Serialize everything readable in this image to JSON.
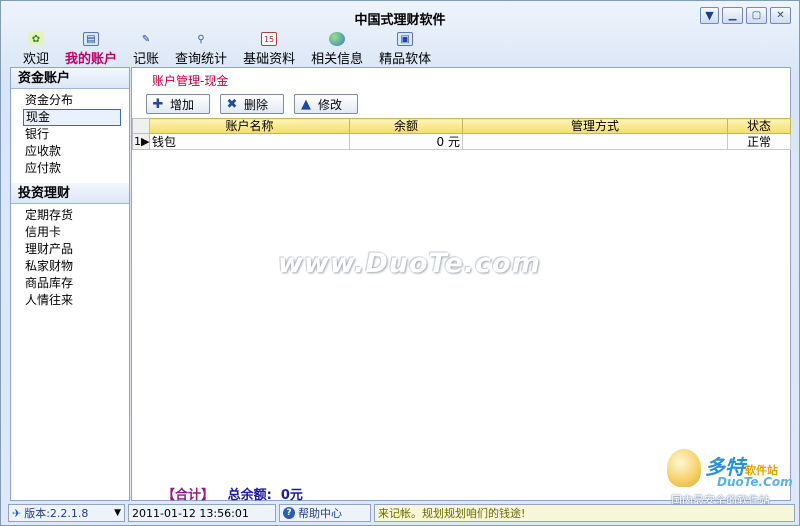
{
  "window": {
    "title": "中国式理财软件"
  },
  "toolbar": {
    "items": [
      {
        "label": "欢迎",
        "icon": "welcome-icon"
      },
      {
        "label": "我的账户",
        "icon": "account-icon",
        "active": true
      },
      {
        "label": "记账",
        "icon": "pen-icon"
      },
      {
        "label": "查询统计",
        "icon": "magnifier-icon"
      },
      {
        "label": "基础资料",
        "icon": "calendar-icon"
      },
      {
        "label": "相关信息",
        "icon": "globe-icon"
      },
      {
        "label": "精品软体",
        "icon": "window-icon"
      }
    ]
  },
  "sidebar": {
    "funds": {
      "header": "资金账户",
      "items": [
        "资金分布",
        "现金",
        "银行",
        "应收款",
        "应付款"
      ],
      "selected": "现金"
    },
    "invest": {
      "header": "投资理财",
      "items": [
        "定期存货",
        "信用卡",
        "理财产品",
        "私家财物",
        "商品库存",
        "人情往来"
      ]
    }
  },
  "main": {
    "breadcrumb": "账户管理-现金",
    "buttons": {
      "add": "增加",
      "delete": "删除",
      "edit": "修改"
    },
    "table": {
      "columns": [
        "账户名称",
        "余额",
        "管理方式",
        "状态"
      ],
      "rows": [
        {
          "index": "1",
          "name": "钱包",
          "balance": "0 元",
          "method": "",
          "status": "正常"
        }
      ]
    },
    "watermark": "www.DuoTe.com",
    "summary": {
      "label": "【合计】",
      "total_label": "总余额:",
      "total_value": "0元"
    }
  },
  "brand": {
    "name": "多特",
    "suffix": "软件站",
    "site": "DuoTe.Com",
    "slogan": "国内最安全的软件站"
  },
  "status": {
    "version": "版本:2.2.1.8",
    "datetime": "2011-01-12 13:56:01",
    "help": "帮助中心",
    "message": "来记帐。规划规划咱们的钱途!"
  },
  "colors": {
    "accent": "#c0006a",
    "header_bg": "#f2dc6c",
    "frame": "#8aa6cf"
  }
}
